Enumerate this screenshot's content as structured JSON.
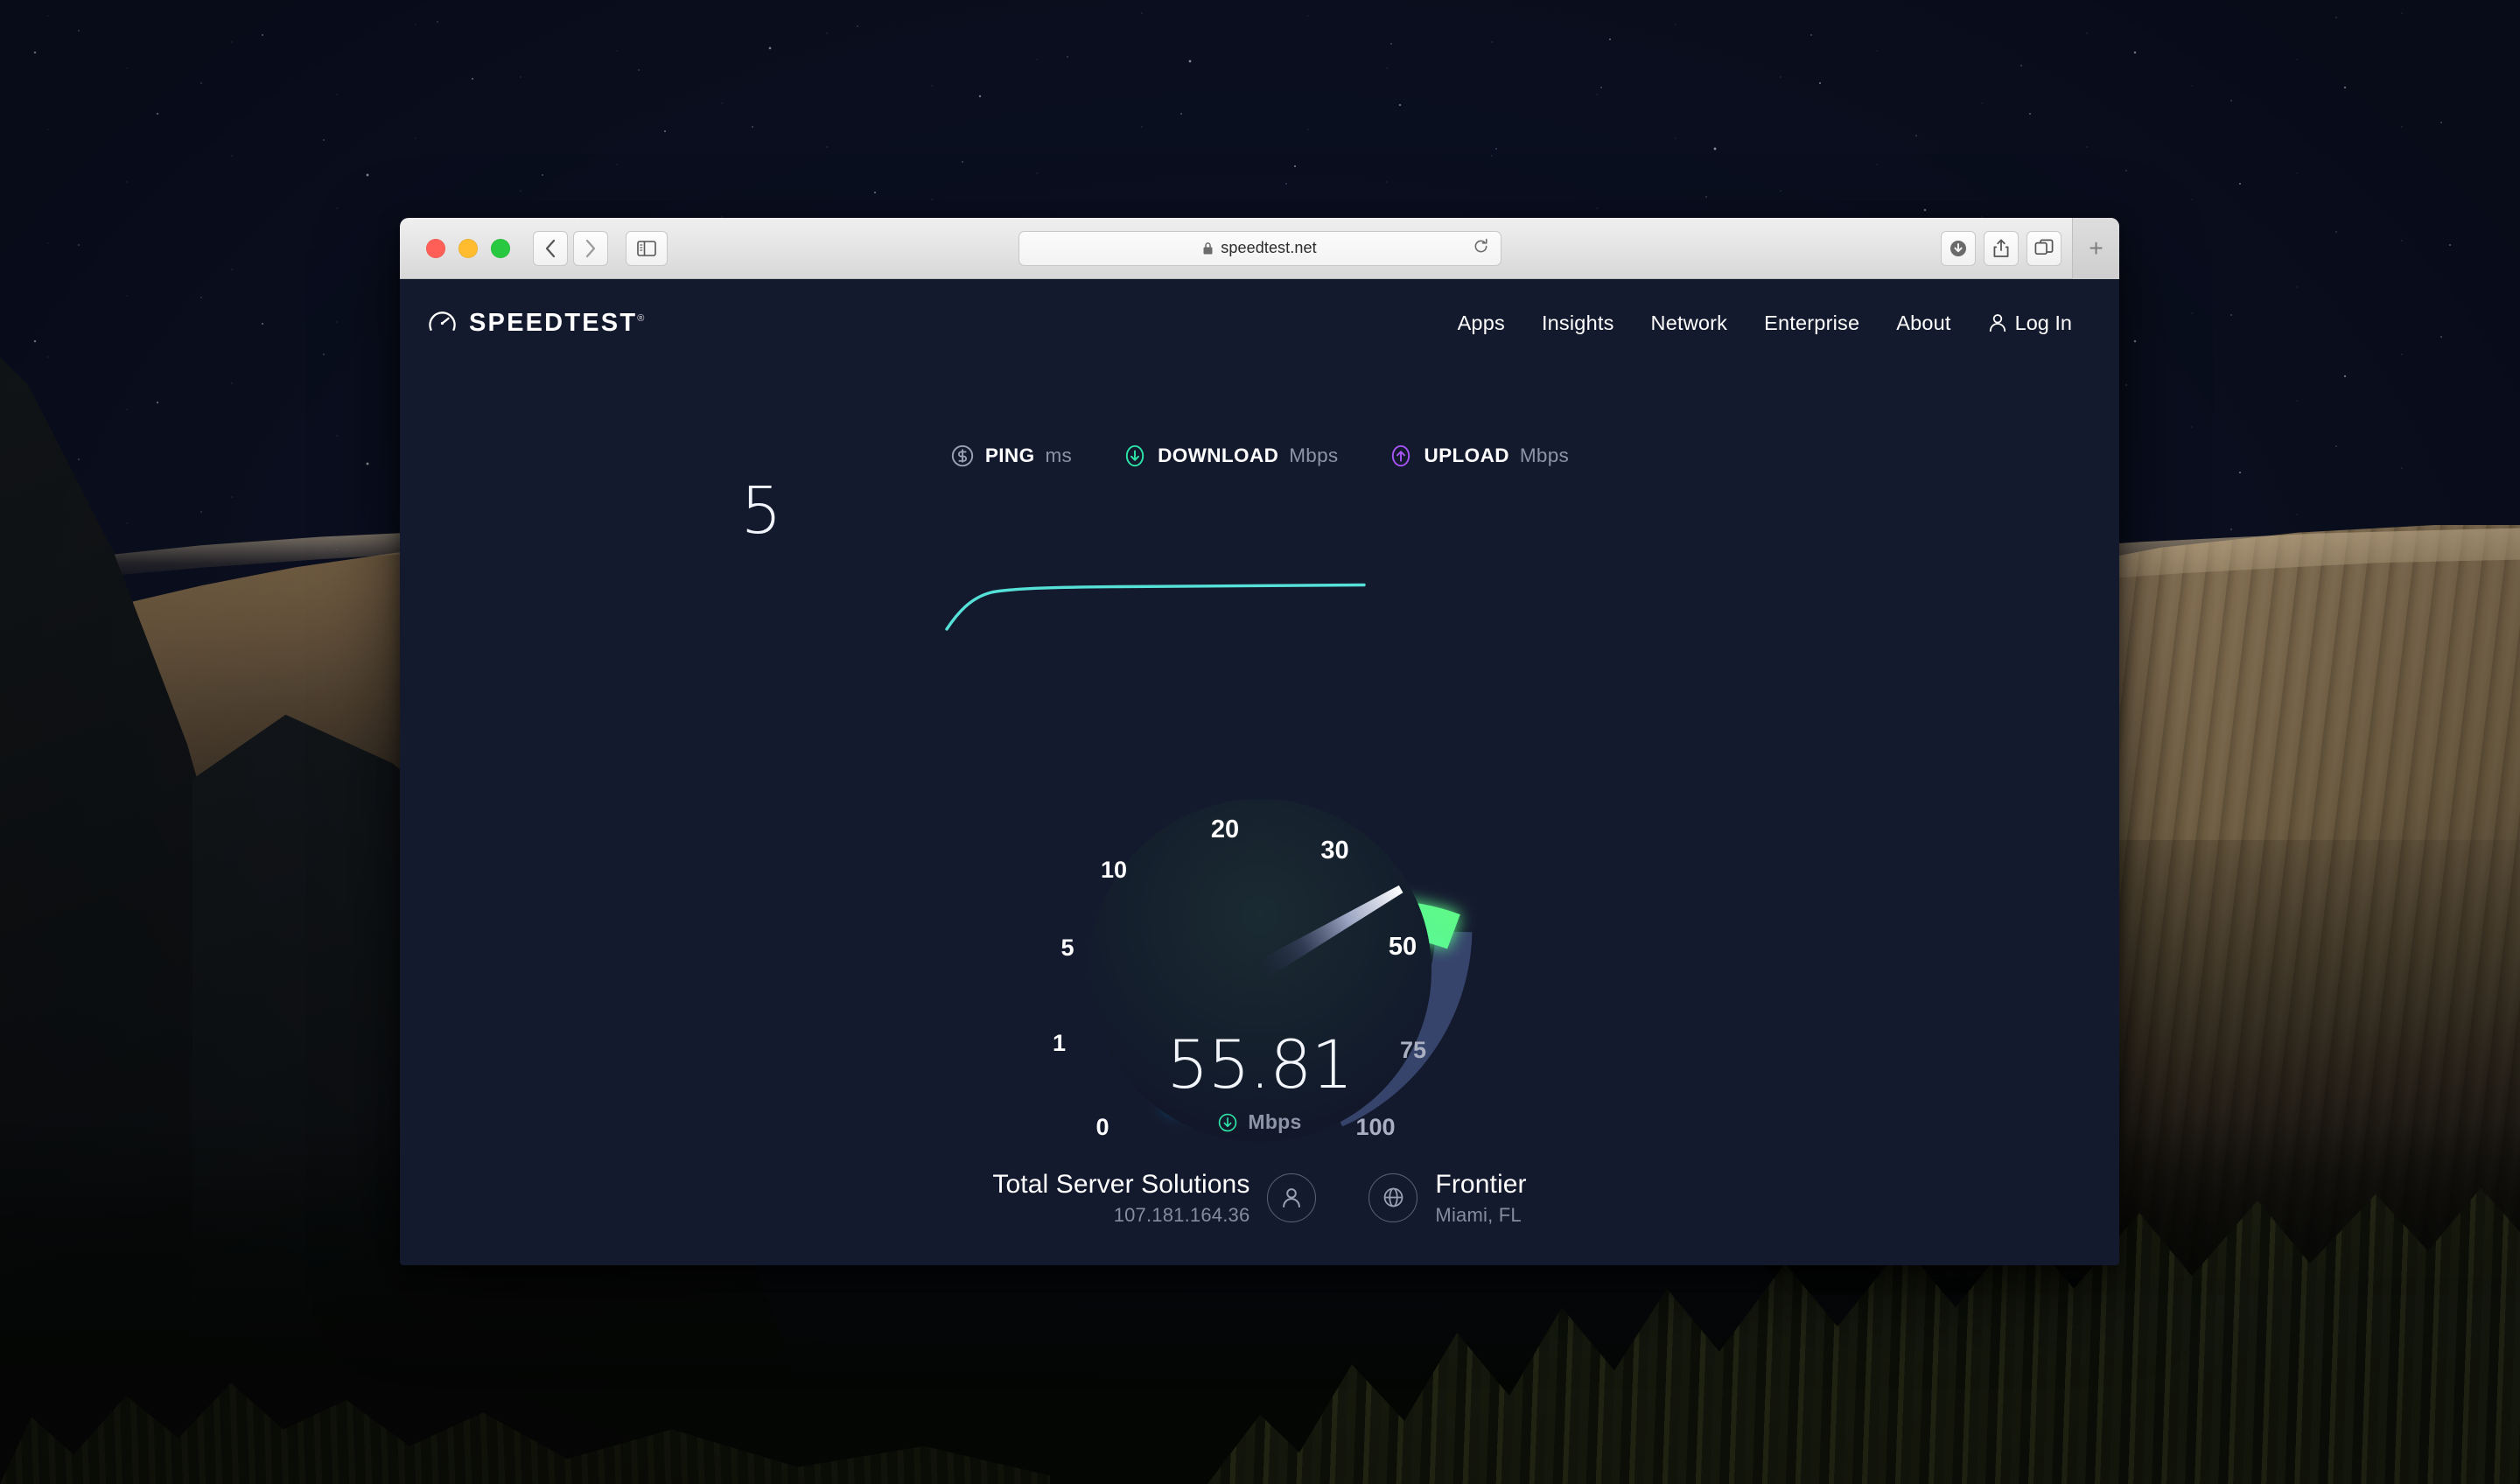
{
  "browser": {
    "url": "speedtest.net",
    "lock_icon": "lock-icon",
    "reload_icon": "reload-icon",
    "back_icon": "back-chevron-icon",
    "forward_icon": "forward-chevron-icon",
    "sidebar_icon": "sidebar-toggle-icon",
    "downloads_icon": "downloads-icon",
    "share_icon": "share-icon",
    "tabs_icon": "tab-overview-icon",
    "newtab_label": "+",
    "traffic_lights": [
      "close",
      "minimize",
      "zoom"
    ]
  },
  "site": {
    "logo_text": "SPEEDTEST",
    "logo_icon": "speedometer-icon",
    "logo_trademark": "®",
    "nav": [
      {
        "label": "Apps"
      },
      {
        "label": "Insights"
      },
      {
        "label": "Network"
      },
      {
        "label": "Enterprise"
      },
      {
        "label": "About"
      }
    ],
    "login": {
      "label": "Log In",
      "icon": "person-icon"
    }
  },
  "metrics": [
    {
      "id": "ping",
      "name": "PING",
      "unit": "ms",
      "icon": "ping-icon",
      "color": "#9aa1b4"
    },
    {
      "id": "download",
      "name": "DOWNLOAD",
      "unit": "Mbps",
      "icon": "download-arrow-icon",
      "color": "#2ee6a8"
    },
    {
      "id": "upload",
      "name": "UPLOAD",
      "unit": "Mbps",
      "icon": "upload-arrow-icon",
      "color": "#a855f7"
    }
  ],
  "results": {
    "ping_value": "5",
    "download_value": "55.81",
    "download_unit": "Mbps",
    "download_unit_icon": "download-arrow-icon",
    "upload_value": ""
  },
  "gauge": {
    "tick_labels": [
      "0",
      "1",
      "5",
      "10",
      "20",
      "30",
      "50",
      "75",
      "100"
    ],
    "needle_value": 55.81,
    "scale_max": 100,
    "arc_colors": {
      "start_blue": "#16b5f7",
      "mid_cyan": "#3ce8e0",
      "end_green": "#5ef98a",
      "track_dark": "#36436b"
    }
  },
  "footer": {
    "server": {
      "name": "Total Server Solutions",
      "detail": "107.181.164.36",
      "icon": "person-icon"
    },
    "isp": {
      "name": "Frontier",
      "detail": "Miami, FL",
      "icon": "globe-icon"
    }
  },
  "chart_data": {
    "type": "line",
    "title": "Ping latency trace",
    "x": [
      0,
      1,
      2,
      3,
      4,
      5,
      6,
      7,
      8,
      9,
      10
    ],
    "values": [
      0,
      3.6,
      4.7,
      5,
      5,
      5,
      5,
      5,
      5,
      5,
      5
    ],
    "ylabel": "ms",
    "series": [
      {
        "name": "Ping",
        "values": [
          0,
          3.6,
          4.7,
          5,
          5,
          5,
          5,
          5,
          5,
          5,
          5
        ],
        "color": "#56e1d8"
      }
    ]
  }
}
